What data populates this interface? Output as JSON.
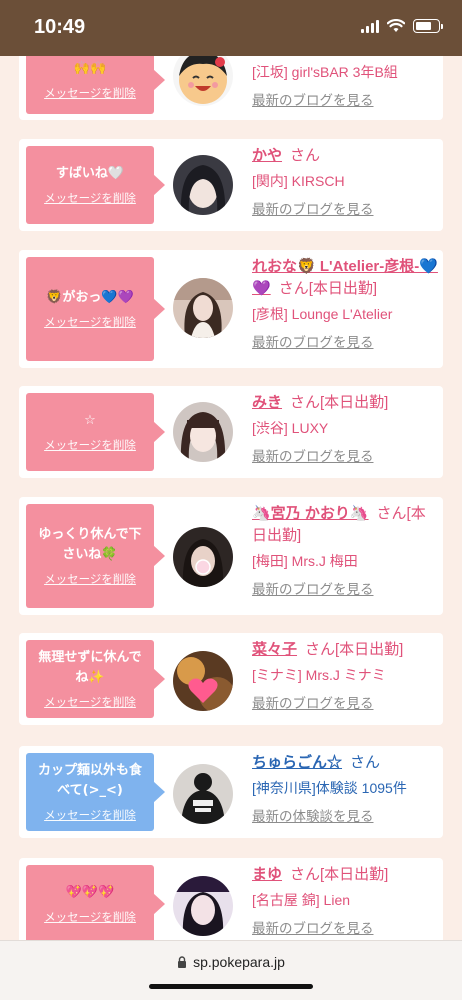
{
  "status_bar": {
    "time": "10:49"
  },
  "url": "sp.pokepara.jp",
  "delete_label": "メッセージを削除",
  "cards": [
    {
      "message": "🙌🙌",
      "name": "",
      "san": "",
      "shop": "[江坂] girl'sBAR 3年B組",
      "blog": "最新のブログを見る",
      "color": "pink"
    },
    {
      "message": "すばいね🤍",
      "name": "かや",
      "san": "さん",
      "shop": "[関内] KIRSCH",
      "blog": "最新のブログを見る",
      "color": "pink"
    },
    {
      "message": "🦁がおっ💙💜",
      "name": "れおな🦁 L'Atelier-彦根-💙💜",
      "san": "さん[本日出勤]",
      "shop": "[彦根] Lounge L'Atelier",
      "blog": "最新のブログを見る",
      "color": "pink"
    },
    {
      "message": "☆",
      "name": "みき",
      "san": "さん[本日出勤]",
      "shop": "[渋谷] LUXY",
      "blog": "最新のブログを見る",
      "color": "pink"
    },
    {
      "message": "ゆっくり休んで下さいね🍀",
      "name": "🦄宮乃 かおり🦄",
      "san": "さん[本日出勤]",
      "shop": "[梅田] Mrs.J 梅田",
      "blog": "最新のブログを見る",
      "color": "pink"
    },
    {
      "message": "無理せずに休んでね✨",
      "name": "菜々子",
      "san": "さん[本日出勤]",
      "shop": "[ミナミ] Mrs.J ミナミ",
      "blog": "最新のブログを見る",
      "color": "pink"
    },
    {
      "message": "カップ麺以外も食べて(>_<)",
      "name": "ちゅらごん☆",
      "san": "さん",
      "shop": "[神奈川県]体験談 1095件",
      "blog": "最新の体験談を見る",
      "color": "blue"
    },
    {
      "message": "💖💖💖",
      "name": "まゆ",
      "san": "さん[本日出勤]",
      "shop": "[名古屋 錦] Lien",
      "blog": "最新のブログを見る",
      "color": "pink"
    }
  ]
}
